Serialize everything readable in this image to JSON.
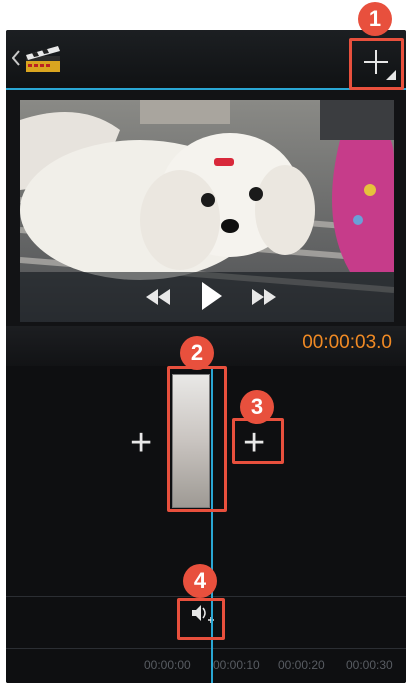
{
  "app": {
    "back_icon": "chevron-left-icon",
    "logo_icon": "clapperboard-icon",
    "add_media_icon": "plus-icon"
  },
  "preview": {
    "controls": [
      "rewind-icon",
      "play-icon",
      "fast-forward-icon"
    ],
    "timecode": "00:00:03.0"
  },
  "timeline": {
    "ruler_labels": [
      "00:00:00",
      "00:00:10",
      "00:00:20",
      "00:00:30"
    ],
    "add_before_icon": "plus-icon",
    "add_after_icon": "plus-icon",
    "audio_add_icon": "audio-add-icon"
  },
  "callouts": [
    "1",
    "2",
    "3",
    "4"
  ],
  "colors": {
    "accent": "#2aa7d4",
    "timecode": "#f08a24",
    "callout": "#e8503d"
  }
}
